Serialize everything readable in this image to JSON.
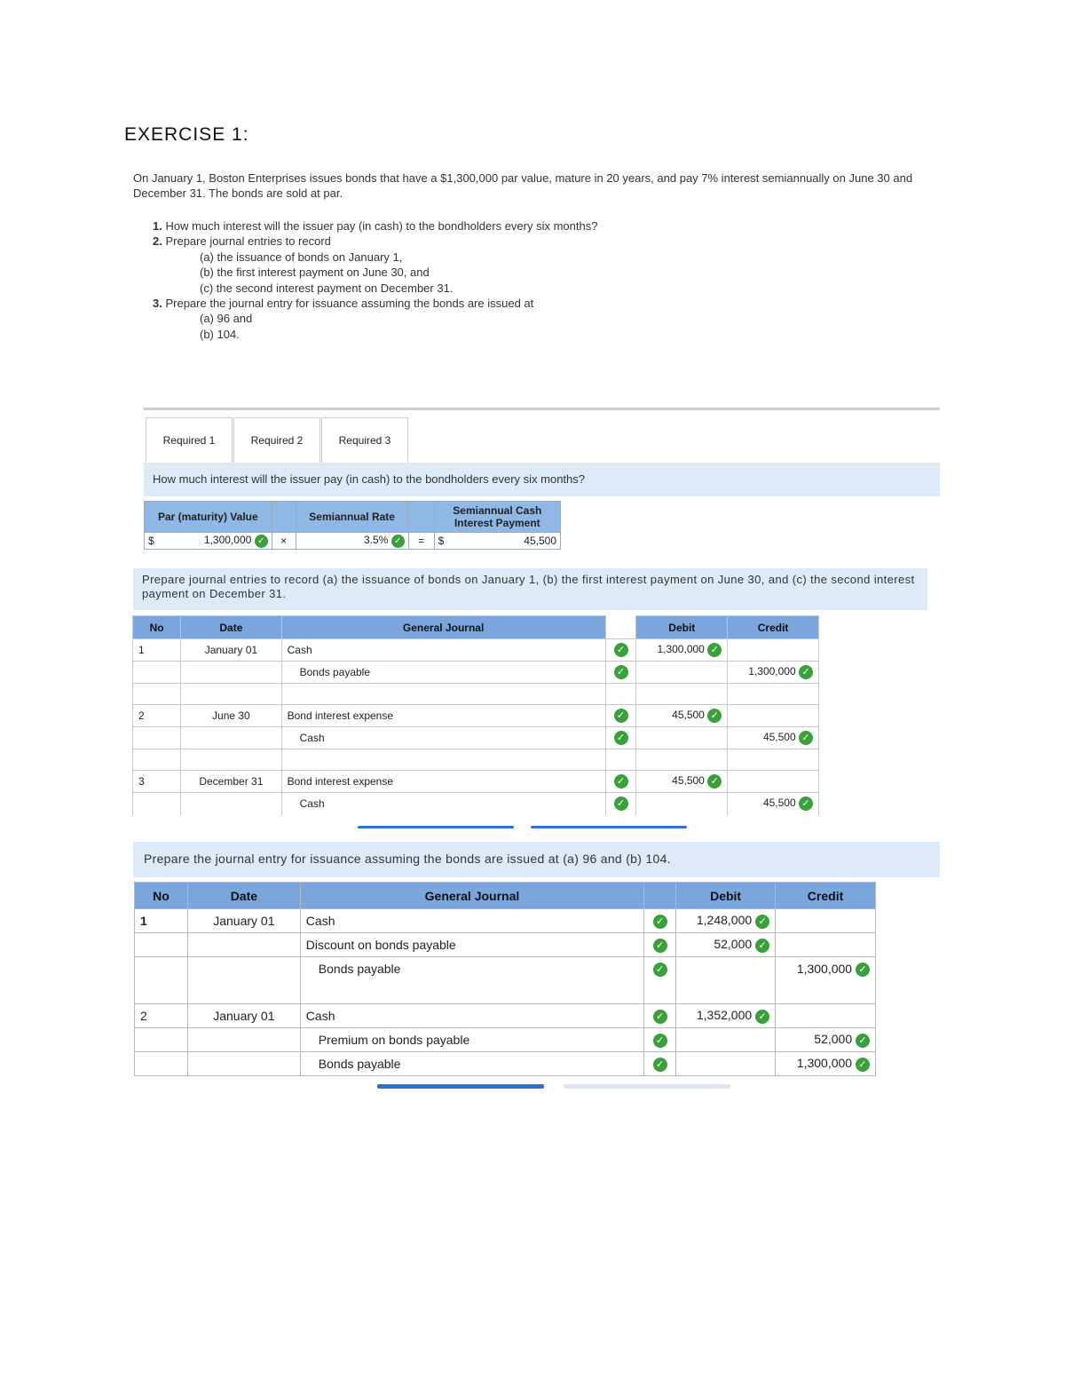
{
  "title": "EXERCISE 1:",
  "intro": "On January 1, Boston Enterprises issues bonds that have a $1,300,000 par value, mature in 20 years, and pay 7% interest semiannually on June 30 and December 31. The bonds are sold at par.",
  "questions": {
    "q1_num": "1.",
    "q1": "How much interest will the issuer pay (in cash) to the bondholders every six months?",
    "q2_num": "2.",
    "q2": "Prepare journal entries to record",
    "q2a": "(a) the issuance of bonds on January 1,",
    "q2b": "(b) the first interest payment on June 30, and",
    "q2c": "(c) the second interest payment on December 31.",
    "q3_num": "3.",
    "q3": "Prepare the journal entry for issuance assuming the bonds are issued at",
    "q3a": "(a) 96 and",
    "q3b": "(b) 104."
  },
  "tabs": [
    "Required 1",
    "Required 2",
    "Required 3"
  ],
  "req1": {
    "prompt": "How much interest will the issuer pay (in cash) to the bondholders every six months?",
    "headers": [
      "Par (maturity) Value",
      "Semiannual Rate",
      "Semiannual Cash Interest Payment"
    ],
    "dollar": "$",
    "par": "1,300,000",
    "times": "×",
    "rate": "3.5%",
    "equals": "=",
    "dollar2": "$",
    "payment": "45,500"
  },
  "req2": {
    "prompt": "Prepare journal entries to record (a) the issuance of bonds on January 1, (b) the first interest payment on June 30, and (c) the second interest payment on December 31.",
    "headers": {
      "no": "No",
      "date": "Date",
      "journal": "General Journal",
      "debit": "Debit",
      "credit": "Credit"
    },
    "rows": [
      {
        "no": "1",
        "date": "January 01",
        "account": "Cash",
        "debit": "1,300,000",
        "credit": ""
      },
      {
        "no": "",
        "date": "",
        "account": "Bonds payable",
        "debit": "",
        "credit": "1,300,000"
      },
      {
        "no": "2",
        "date": "June 30",
        "account": "Bond interest expense",
        "debit": "45,500",
        "credit": ""
      },
      {
        "no": "",
        "date": "",
        "account": "Cash",
        "debit": "",
        "credit": "45,500"
      },
      {
        "no": "3",
        "date": "December 31",
        "account": "Bond interest expense",
        "debit": "45,500",
        "credit": ""
      },
      {
        "no": "",
        "date": "",
        "account": "Cash",
        "debit": "",
        "credit": "45,500"
      }
    ]
  },
  "req3": {
    "prompt": "Prepare the journal entry for issuance assuming the bonds are issued at (a) 96 and (b) 104.",
    "headers": {
      "no": "No",
      "date": "Date",
      "journal": "General Journal",
      "debit": "Debit",
      "credit": "Credit"
    },
    "rows": [
      {
        "no": "1",
        "date": "January 01",
        "account": "Cash",
        "debit": "1,248,000",
        "credit": ""
      },
      {
        "no": "",
        "date": "",
        "account": "Discount on bonds payable",
        "debit": "52,000",
        "credit": ""
      },
      {
        "no": "",
        "date": "",
        "account": "Bonds payable",
        "debit": "",
        "credit": "1,300,000"
      },
      {
        "no": "2",
        "date": "January 01",
        "account": "Cash",
        "debit": "1,352,000",
        "credit": ""
      },
      {
        "no": "",
        "date": "",
        "account": "Premium on bonds payable",
        "debit": "",
        "credit": "52,000"
      },
      {
        "no": "",
        "date": "",
        "account": "Bonds payable",
        "debit": "",
        "credit": "1,300,000"
      }
    ]
  },
  "colors": {
    "accent": "#2f6fcf",
    "header": "#7aa6dd",
    "banner": "#dcebf7",
    "check": "#3aa13a"
  },
  "icons": {
    "check": "checkmark-circle-icon"
  }
}
